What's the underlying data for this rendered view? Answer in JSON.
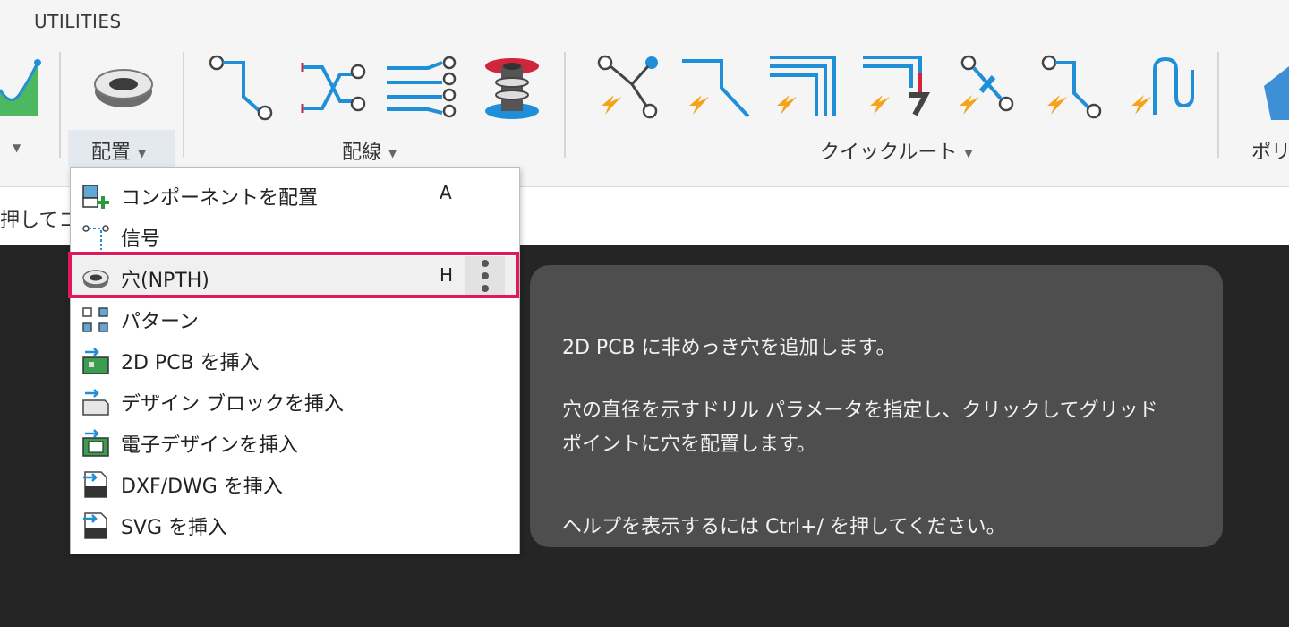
{
  "ribbon": {
    "tab_label": "UTILITIES",
    "groups": [
      {
        "label": "配置"
      },
      {
        "label": "配線"
      },
      {
        "label": "クイックルート"
      },
      {
        "label": "ポリ"
      }
    ]
  },
  "hint": {
    "text": "押してコ"
  },
  "menu": {
    "items": [
      {
        "label": "コンポーネントを配置",
        "shortcut": "A",
        "icon": "component-place-icon"
      },
      {
        "label": "信号",
        "shortcut": "",
        "icon": "signal-icon"
      },
      {
        "label": "穴(NPTH)",
        "shortcut": "H",
        "icon": "hole-icon"
      },
      {
        "label": "パターン",
        "shortcut": "",
        "icon": "pattern-icon"
      },
      {
        "label": "2D PCB を挿入",
        "shortcut": "",
        "icon": "insert-2d-pcb-icon"
      },
      {
        "label": "デザイン ブロックを挿入",
        "shortcut": "",
        "icon": "insert-design-block-icon"
      },
      {
        "label": "電子デザインを挿入",
        "shortcut": "",
        "icon": "insert-electronic-design-icon"
      },
      {
        "label": "DXF/DWG を挿入",
        "shortcut": "",
        "icon": "insert-dxf-icon"
      },
      {
        "label": "SVG を挿入",
        "shortcut": "",
        "icon": "insert-svg-icon"
      }
    ]
  },
  "tooltip": {
    "line1": "2D PCB に非めっき穴を追加します。",
    "line2": "穴の直径を示すドリル パラメータを指定し、クリックしてグリッド",
    "line3": "ポイントに穴を配置します。",
    "line4": "ヘルプを表示するには Ctrl+/ を押してください。"
  },
  "colors": {
    "highlight": "#e0195a",
    "accent_blue": "#1f8fd8",
    "accent_orange": "#f5a31a"
  }
}
